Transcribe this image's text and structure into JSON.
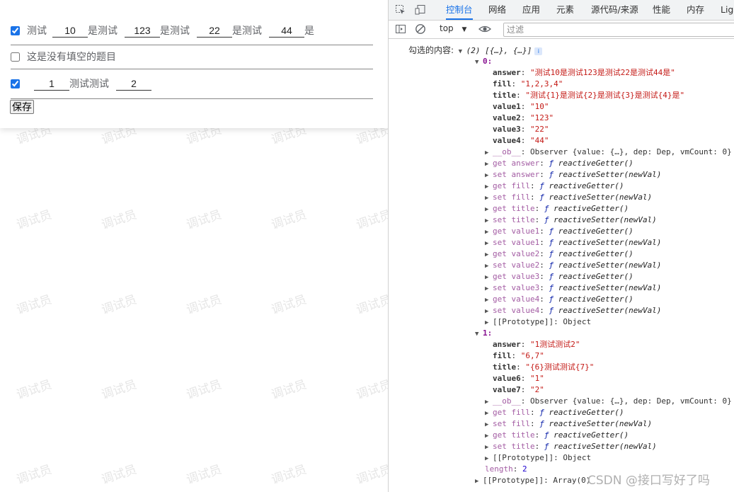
{
  "watermark_text": "调试员",
  "form": {
    "q1": {
      "checked": true,
      "segments": [
        "测试",
        "是测试",
        "是测试",
        "是测试",
        "是"
      ],
      "values": [
        "10",
        "123",
        "22",
        "44"
      ]
    },
    "q2": {
      "checked": false,
      "text": "这是没有填空的题目"
    },
    "q3": {
      "checked": true,
      "values": [
        "1",
        "2"
      ],
      "middle": "测试测试"
    },
    "save_label": "保存"
  },
  "devtools": {
    "tabs": [
      "控制台",
      "网络",
      "应用",
      "元素",
      "源代码/来源",
      "性能",
      "内存",
      "Ligh"
    ],
    "active_tab": "控制台",
    "context": "top",
    "filter_placeholder": "过滤",
    "log_label": "勾选的内容:",
    "array_summary": "(2) [{…}, {…}]",
    "info_badge": "i",
    "item0": {
      "index": "0:",
      "answer": "\"测试10是测试123是测试22是测试44是\"",
      "fill": "\"1,2,3,4\"",
      "title": "\"测试{1}是测试{2}是测试{3}是测试{4}是\"",
      "value1": "\"10\"",
      "value2": "\"123\"",
      "value3": "\"22\"",
      "value4": "\"44\""
    },
    "item1": {
      "index": "1:",
      "answer": "\"1测试测试2\"",
      "fill": "\"6,7\"",
      "title": "\"{6}测试测试{7}\"",
      "value6": "\"1\"",
      "value7": "\"2\""
    },
    "ob_line": "Observer {value: {…}, dep: Dep, vmCount: 0}",
    "getter": "reactiveGetter()",
    "setter": "reactiveSetter(newVal)",
    "prototype_object": "[[Prototype]]: Object",
    "length_label": "length",
    "length_value": "2",
    "prototype_array": "[[Prototype]]: Array(0)",
    "item0_accessors": [
      "answer",
      "fill",
      "title",
      "value1",
      "value2",
      "value3",
      "value4"
    ],
    "item1_accessors": [
      "fill",
      "title"
    ]
  },
  "csdn_watermark": "CSDN @接口写好了吗"
}
